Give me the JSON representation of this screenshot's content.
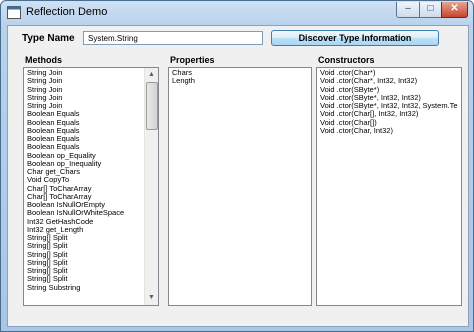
{
  "window": {
    "title": "Reflection Demo",
    "controls": {
      "minimize": "–",
      "maximize": "□",
      "close": "✕"
    }
  },
  "form": {
    "type_name_label": "Type Name",
    "type_name_value": "System.String",
    "discover_button": "Discover Type Information"
  },
  "methods": {
    "label": "Methods",
    "items": [
      "String Join",
      "String Join",
      "String Join",
      "String Join",
      "String Join",
      "Boolean Equals",
      "Boolean Equals",
      "Boolean Equals",
      "Boolean Equals",
      "Boolean Equals",
      "Boolean op_Equality",
      "Boolean op_Inequality",
      "Char get_Chars",
      "Void CopyTo",
      "Char[] ToCharArray",
      "Char[] ToCharArray",
      "Boolean IsNullOrEmpty",
      "Boolean IsNullOrWhiteSpace",
      "Int32 GetHashCode",
      "Int32 get_Length",
      "String[] Split",
      "String[] Split",
      "String[] Split",
      "String[] Split",
      "String[] Split",
      "String[] Split",
      "String Substring"
    ]
  },
  "properties": {
    "label": "Properties",
    "items": [
      "Chars",
      "Length"
    ]
  },
  "constructors": {
    "label": "Constructors",
    "items": [
      "Void .ctor(Char*)",
      "Void .ctor(Char*, Int32, Int32)",
      "Void .ctor(SByte*)",
      "Void .ctor(SByte*, Int32, Int32)",
      "Void .ctor(SByte*, Int32, Int32, System.Te",
      "Void .ctor(Char[], Int32, Int32)",
      "Void .ctor(Char[])",
      "Void .ctor(Char, Int32)"
    ]
  },
  "colors": {
    "title_bar": "#b9d2ec",
    "close_button": "#c7452a",
    "button_accent": "#3c7fb1"
  }
}
